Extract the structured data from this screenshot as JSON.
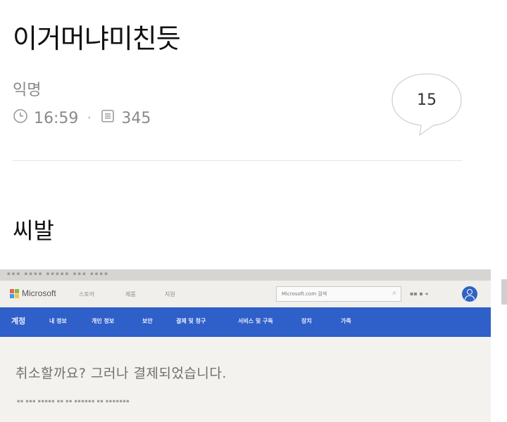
{
  "post": {
    "title": "이거머냐미친듯",
    "author": "익명",
    "time": "16:59",
    "views": "345",
    "comments": "15",
    "body": "씨발"
  },
  "icons": {
    "time": "clock-icon",
    "views": "document-icon",
    "comments": "speech-bubble-icon"
  },
  "photo": {
    "brand": "Microsoft",
    "top_nav": [
      "스토어",
      "제품",
      "지원"
    ],
    "search_placeholder": "Microsoft.com 검색",
    "blue_nav": [
      "계정",
      "내 정보",
      "개인 정보",
      "보안",
      "결제 및 청구",
      "서비스 및 구독",
      "장치",
      "가족"
    ],
    "heading": "취소할까요? 그러나 결제되었습니다.",
    "colors": {
      "blue_bar": "#2f5fc8",
      "avatar": "#2f63c4"
    }
  }
}
